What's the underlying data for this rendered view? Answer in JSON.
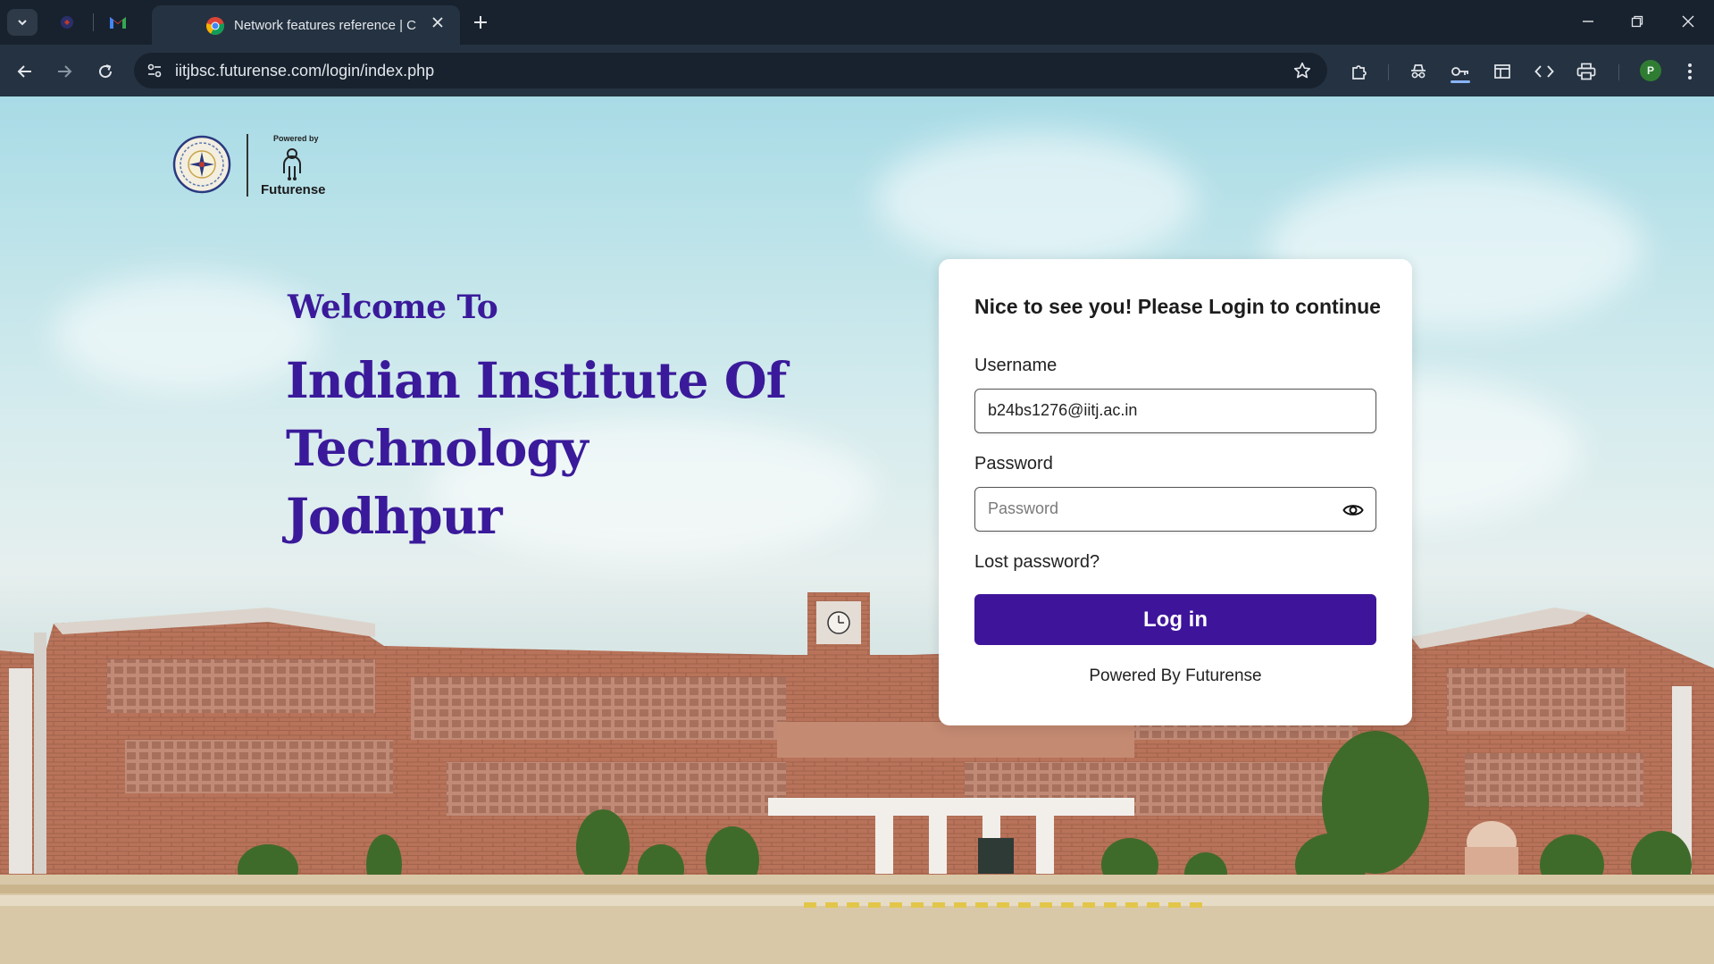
{
  "browser": {
    "active_tab_title": "Network features reference | C",
    "url": "iitjbsc.futurense.com/login/index.php",
    "profile_initial": "P"
  },
  "page": {
    "logo": {
      "powered_by": "Powered by",
      "brand": "Futurense"
    },
    "welcome": "Welcome To",
    "institute_lines": [
      "Indian Institute Of",
      "Technology",
      "Jodhpur"
    ]
  },
  "login": {
    "heading": "Nice to see you! Please Login to continue",
    "username_label": "Username",
    "username_value": "b24bs1276@iitj.ac.in",
    "password_label": "Password",
    "password_placeholder": "Password",
    "lost_password": "Lost password?",
    "submit_label": "Log in",
    "footer": "Powered By Futurense"
  },
  "colors": {
    "brand_purple": "#3e159a",
    "heading_purple": "#3a1a9a"
  }
}
